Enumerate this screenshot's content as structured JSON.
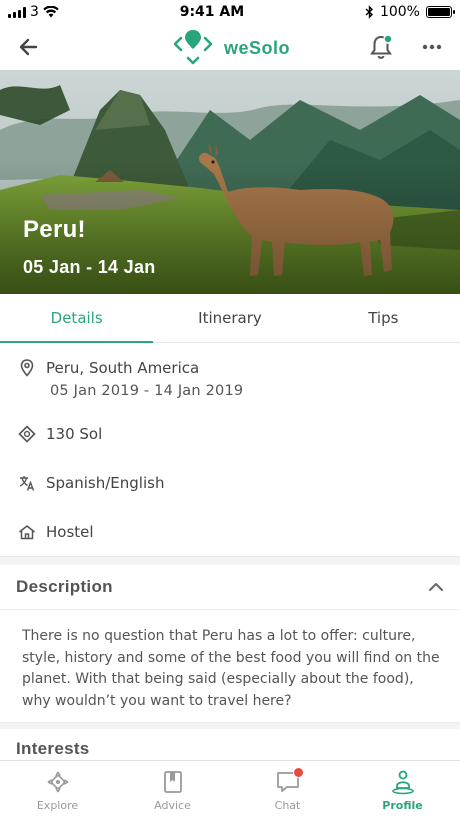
{
  "status": {
    "carrier": "3",
    "time": "9:41 AM",
    "battery": "100%"
  },
  "header": {
    "brand": "weSolo",
    "back_icon": "arrow-left",
    "notification_icon": "bell",
    "more_icon": "ellipsis"
  },
  "hero": {
    "title": "Peru!",
    "dates": "05 Jan - 14 Jan"
  },
  "tabs": [
    {
      "label": "Details",
      "active": true
    },
    {
      "label": "Itinerary",
      "active": false
    },
    {
      "label": "Tips",
      "active": false
    }
  ],
  "details": {
    "location": "Peru, South America",
    "date_range": "05 Jan 2019 - 14 Jan 2019",
    "budget": "130 Sol",
    "languages": "Spanish/English",
    "accommodation": "Hostel"
  },
  "description": {
    "title": "Description",
    "body": "There is no question that Peru has a lot to offer: culture, style, history and some of the best food you will find on the planet. With that being said (especially about the food), why wouldn’t you want to travel here?"
  },
  "interests": {
    "title": "Interests"
  },
  "bottom_nav": [
    {
      "label": "Explore",
      "icon": "explore-icon",
      "active": false
    },
    {
      "label": "Advice",
      "icon": "book-icon",
      "active": false
    },
    {
      "label": "Chat",
      "icon": "chat-icon",
      "active": false,
      "badge": true
    },
    {
      "label": "Profile",
      "icon": "profile-icon",
      "active": true
    }
  ],
  "colors": {
    "accent": "#2aa57b",
    "badge": "#e74c3c"
  }
}
